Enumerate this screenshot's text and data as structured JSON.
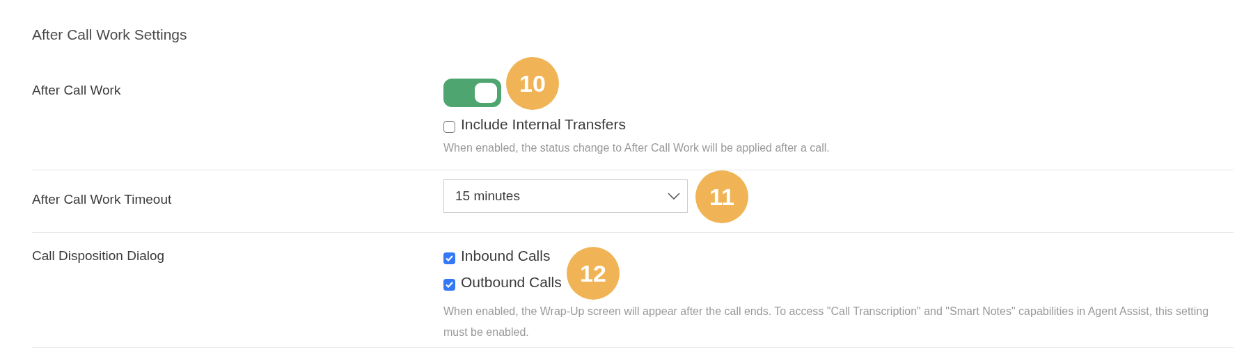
{
  "section_title": "After Call Work Settings",
  "rows": [
    {
      "kind": "toggle",
      "label": "After Call Work",
      "on": true,
      "badge": "10",
      "options": [
        {
          "label": "Include Internal Transfers",
          "checked": false
        }
      ],
      "help": "When enabled, the status change to After Call Work will be applied after a call."
    },
    {
      "kind": "select",
      "label": "After Call Work Timeout",
      "value": "15 minutes",
      "badge": "11"
    },
    {
      "kind": "checkboxes",
      "label": "Call Disposition Dialog",
      "badge": "12",
      "options": [
        {
          "label": "Inbound Calls",
          "checked": true
        },
        {
          "label": "Outbound Calls",
          "checked": true
        }
      ],
      "help": "When enabled, the Wrap-Up screen will appear after the call ends. To access \"Call Transcription\" and \"Smart Notes\" capabilities in Agent Assist, this setting must be enabled."
    }
  ]
}
